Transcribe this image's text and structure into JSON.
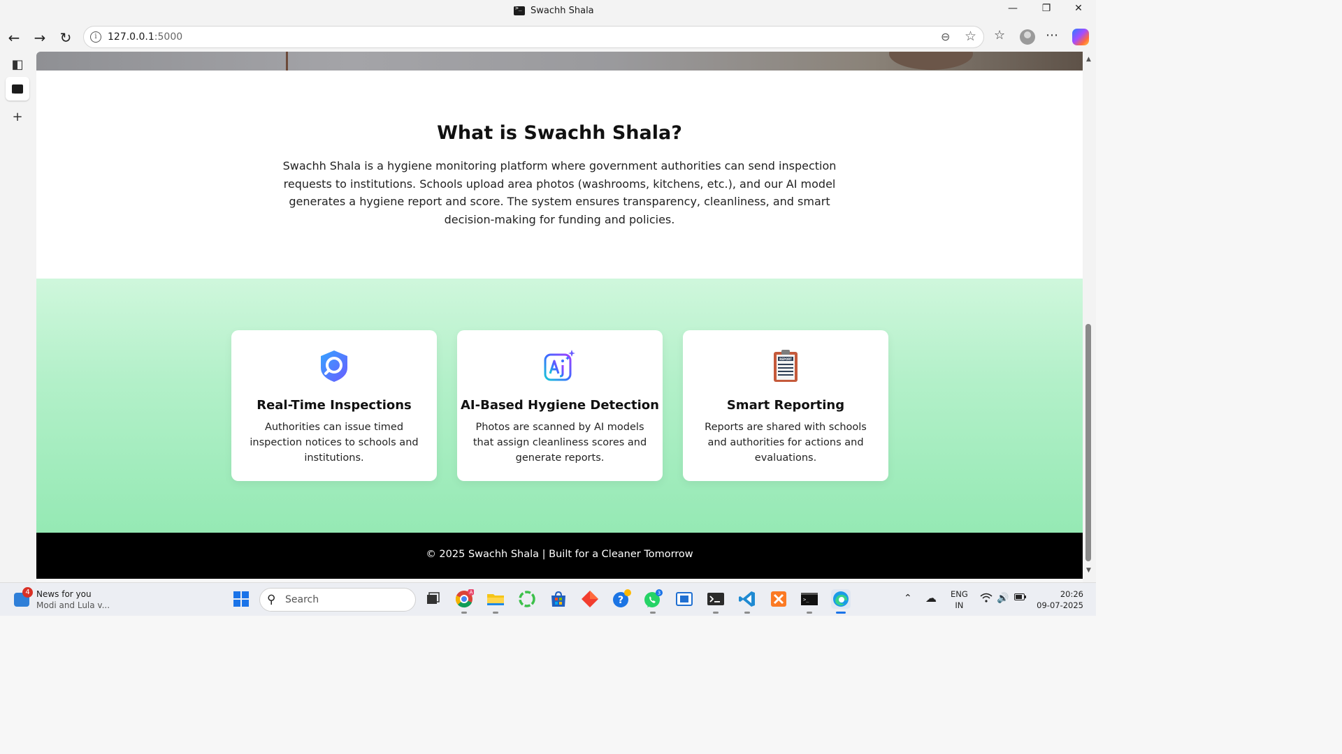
{
  "browser": {
    "tab_title": "Swachh Shala",
    "url_host": "127.0.0.1",
    "url_port": ":5000",
    "window_controls": {
      "minimize": "—",
      "restore": "❐",
      "close": "✕"
    }
  },
  "page": {
    "about": {
      "heading": "What is Swachh Shala?",
      "body": "Swachh Shala is a hygiene monitoring platform where government authorities can send inspection requests to institutions. Schools upload area photos (washrooms, kitchens, etc.), and our AI model generates a hygiene report and score. The system ensures transparency, cleanliness, and smart decision-making for funding and policies."
    },
    "features": [
      {
        "icon": "shield-search-icon",
        "title": "Real-Time Inspections",
        "text": "Authorities can issue timed inspection notices to schools and institutions."
      },
      {
        "icon": "ai-sparkle-icon",
        "title": "AI-Based Hygiene Detection",
        "text": "Photos are scanned by AI models that assign cleanliness scores and generate reports."
      },
      {
        "icon": "report-clipboard-icon",
        "title": "Smart Reporting",
        "text": "Reports are shared with schools and authorities for actions and evaluations."
      }
    ],
    "report_icon_label": "REPORT",
    "footer": "© 2025 Swachh Shala | Built for a Cleaner Tomorrow"
  },
  "taskbar": {
    "news_badge": "4",
    "news_title": "News for you",
    "news_subtitle": "Modi and Lula v...",
    "search_label": "Search",
    "chrome_badge": "A",
    "whatsapp_badge": "3",
    "lang_line1": "ENG",
    "lang_line2": "IN",
    "time": "20:26",
    "date": "09-07-2025"
  },
  "colors": {
    "features_gradient_top": "#cff7dc",
    "features_gradient_bottom": "#95e9b4",
    "footer_bg": "#000000"
  }
}
